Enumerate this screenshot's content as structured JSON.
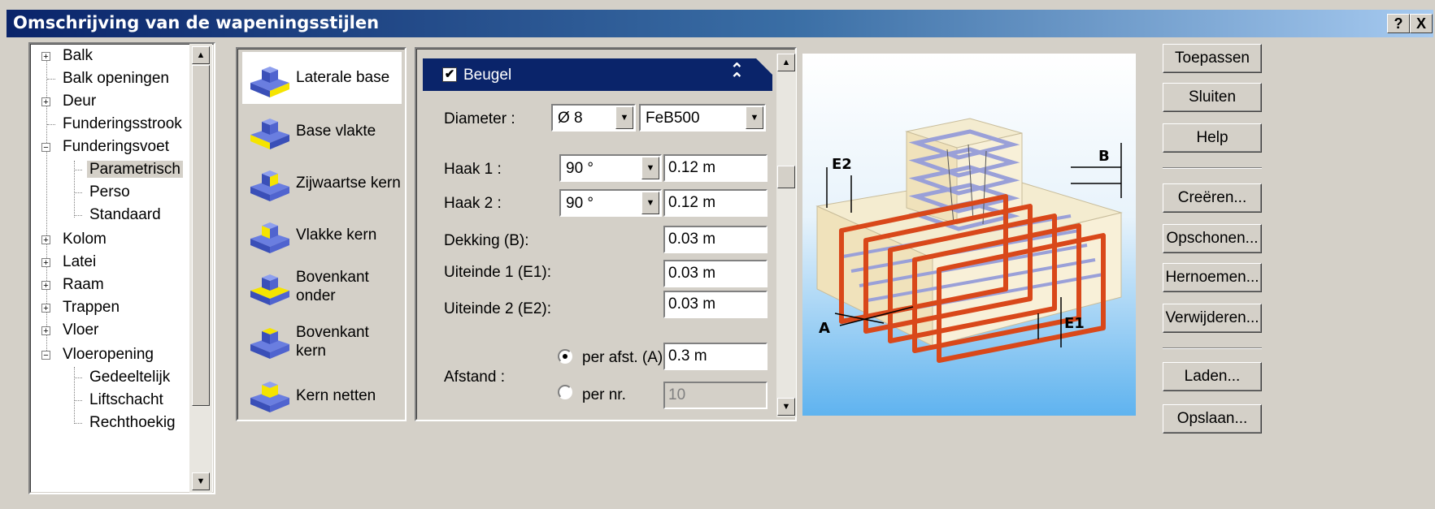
{
  "window": {
    "title": "Omschrijving van de wapeningsstijlen",
    "help_label": "?",
    "close_label": "X"
  },
  "tree": {
    "items": [
      {
        "label": "Balk",
        "expander": "+"
      },
      {
        "label": "Balk openingen",
        "expander": ""
      },
      {
        "label": "Deur",
        "expander": "+"
      },
      {
        "label": "Funderingsstrook",
        "expander": ""
      },
      {
        "label": "Funderingsvoet",
        "expander": "−"
      },
      {
        "label": "Parametrisch",
        "selected": true
      },
      {
        "label": "Perso"
      },
      {
        "label": "Standaard"
      },
      {
        "label": "Kolom",
        "expander": "+"
      },
      {
        "label": "Latei",
        "expander": "+"
      },
      {
        "label": "Raam",
        "expander": "+"
      },
      {
        "label": "Trappen",
        "expander": "+"
      },
      {
        "label": "Vloer",
        "expander": "+"
      },
      {
        "label": "Vloeropening",
        "expander": "−"
      },
      {
        "label": "Gedeeltelijk"
      },
      {
        "label": "Liftschacht"
      },
      {
        "label": "Rechthoekig"
      }
    ]
  },
  "styles": {
    "items": [
      {
        "line1": "Laterale base",
        "line2": "",
        "active": true
      },
      {
        "line1": "Base vlakte",
        "line2": ""
      },
      {
        "line1": "Zijwaartse kern",
        "line2": ""
      },
      {
        "line1": "Vlakke kern",
        "line2": ""
      },
      {
        "line1": "Bovenkant",
        "line2": "onder"
      },
      {
        "line1": "Bovenkant",
        "line2": "kern"
      },
      {
        "line1": "Kern netten",
        "line2": ""
      }
    ]
  },
  "beugel": {
    "header": "Beugel",
    "checked": "✔",
    "collapse_icon": "⌃",
    "diameter_label": "Diameter :",
    "diameter_value": "Ø 8",
    "material_value": "FeB500",
    "haak1_label": "Haak 1 :",
    "haak1_angle": "90 °",
    "haak1_value": "0.12 m",
    "haak2_label": "Haak 2 :",
    "haak2_angle": "90 °",
    "haak2_value": "0.12 m",
    "dekking_label": "Dekking (B):",
    "dekking_value": "0.03 m",
    "uiteinde1_label": "Uiteinde 1 (E1):",
    "uiteinde1_value": "0.03 m",
    "uiteinde2_label": "Uiteinde 2 (E2):",
    "uiteinde2_value": "0.03 m",
    "afstand_label": "Afstand :",
    "per_afst_label": "per afst. (A)",
    "per_afst_value": "0.3 m",
    "per_nr_label": "per nr.",
    "per_nr_value": "10"
  },
  "preview_labels": {
    "e2": "E2",
    "b": "B",
    "a": "A",
    "e1": "E1"
  },
  "buttons": {
    "toepassen": "Toepassen",
    "sluiten": "Sluiten",
    "help": "Help",
    "creeren": "Creëren...",
    "opschonen": "Opschonen...",
    "hernoemen": "Hernoemen...",
    "verwijderen": "Verwijderen...",
    "laden": "Laden...",
    "opslaan": "Opslaan..."
  },
  "colors": {
    "title_start": "#0a246a",
    "title_end": "#a6caf0",
    "rebar": "#d9481a",
    "face": "#f4ecd0",
    "sky": "#7ec3f3"
  }
}
